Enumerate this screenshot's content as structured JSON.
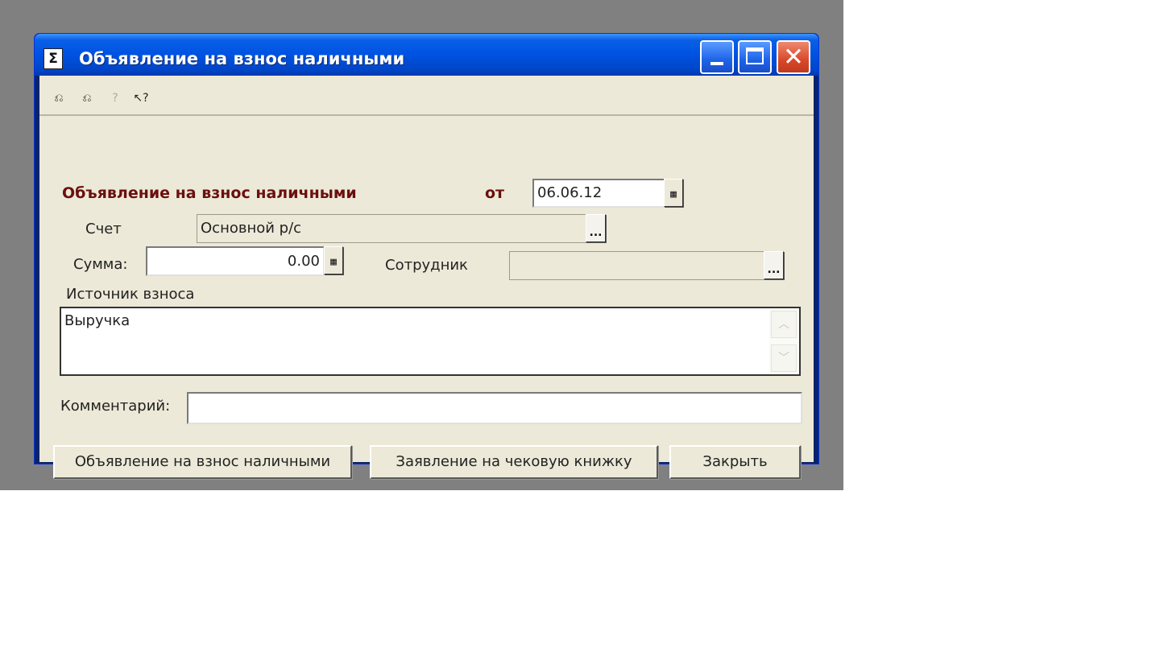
{
  "window": {
    "title": "Объявление на взнос наличными",
    "controls": {
      "minimize": "minimize",
      "maximize": "maximize",
      "close": "✕"
    }
  },
  "toolbar": {
    "icons": [
      "new-record-icon",
      "copy-record-icon",
      "help-icon",
      "context-help-icon"
    ],
    "glyphs": {
      "new": "⎌",
      "copy": "⎌",
      "help": "?",
      "context_help": "↖?"
    }
  },
  "form": {
    "doc_title": "Объявление на взнос наличными",
    "date_label": "от",
    "date_value": "06.06.12",
    "account_label": "Счет",
    "account_value": "Основной р/с",
    "sum_label": "Сумма:",
    "sum_value": "0.00",
    "employee_label": "Сотрудник",
    "employee_value": "",
    "source_label": "Источник взноса",
    "source_value": "Выручка",
    "comment_label": "Комментарий:",
    "comment_value": "",
    "dots": "...",
    "calc_glyph": "▦"
  },
  "buttons": {
    "deposit_notice": "Объявление на взнос наличными",
    "checkbook_request": "Заявление на чековую книжку",
    "close": "Закрыть"
  },
  "colors": {
    "desktop": "#808080",
    "titlebar": "#0054e3",
    "client": "#ece9d8",
    "doc_title": "#6b0f0f",
    "close_button": "#d9482a"
  }
}
